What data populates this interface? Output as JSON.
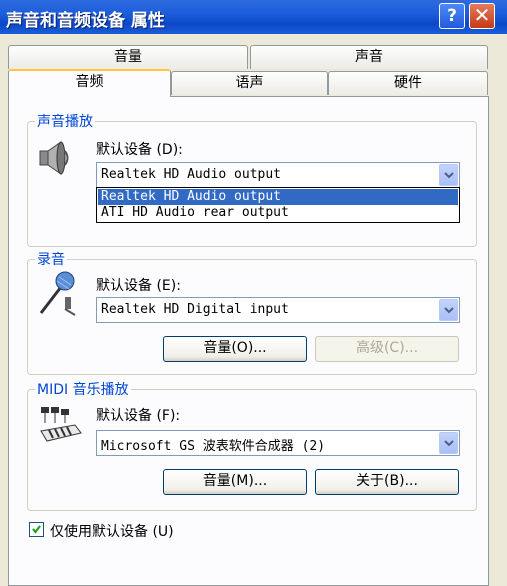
{
  "window": {
    "title": "声音和音频设备 属性",
    "help_label": "?",
    "close_label": "✕"
  },
  "tabs": {
    "row1": [
      "音量",
      "声音"
    ],
    "row2": [
      "音频",
      "语声",
      "硬件"
    ],
    "active": "音频"
  },
  "playback": {
    "group_label": "声音播放",
    "default_label": "默认设备 (D):",
    "selected": "Realtek HD Audio output",
    "options": [
      "Realtek HD Audio output",
      "ATI HD Audio rear output"
    ]
  },
  "recording": {
    "group_label": "录音",
    "default_label": "默认设备 (E):",
    "selected": "Realtek HD Digital input",
    "volume_button": "音量(O)...",
    "advanced_button": "高级(C)..."
  },
  "midi": {
    "group_label": "MIDI 音乐播放",
    "default_label": "默认设备 (F):",
    "selected": "Microsoft GS 波表软件合成器 (2)",
    "volume_button": "音量(M)...",
    "about_button": "关于(B)..."
  },
  "only_default": {
    "label": "仅使用默认设备 (U)",
    "checked": true
  },
  "icons": [
    "speaker-icon",
    "microphone-icon",
    "midi-keyboard-icon",
    "checkmark-icon",
    "dropdown-arrow-icon"
  ]
}
